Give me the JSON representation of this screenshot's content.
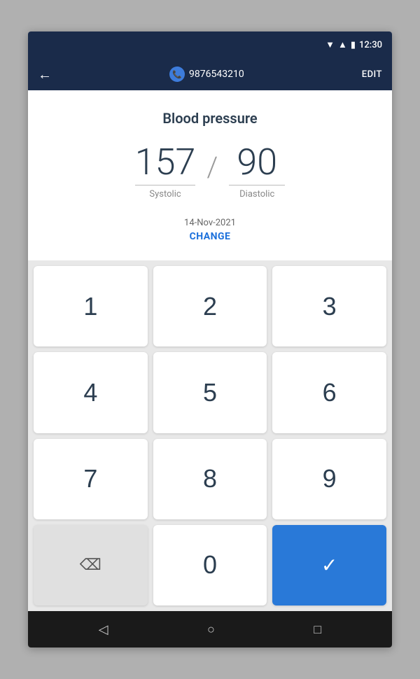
{
  "status_bar": {
    "time": "12:30"
  },
  "header": {
    "back_label": "←",
    "phone_number": "9876543210",
    "edit_label": "EDIT"
  },
  "card": {
    "title": "Blood pressure",
    "systolic_value": "157",
    "systolic_label": "Systolic",
    "diastolic_value": "90",
    "diastolic_label": "Diastolic",
    "date": "14-Nov-2021",
    "change_label": "CHANGE"
  },
  "keypad": {
    "keys": [
      "1",
      "2",
      "3",
      "4",
      "5",
      "6",
      "7",
      "8",
      "9"
    ],
    "backspace_label": "⌫",
    "zero_label": "0",
    "confirm_label": "✓"
  },
  "nav_bar": {
    "back_icon": "◁",
    "home_icon": "○",
    "recent_icon": "□"
  }
}
